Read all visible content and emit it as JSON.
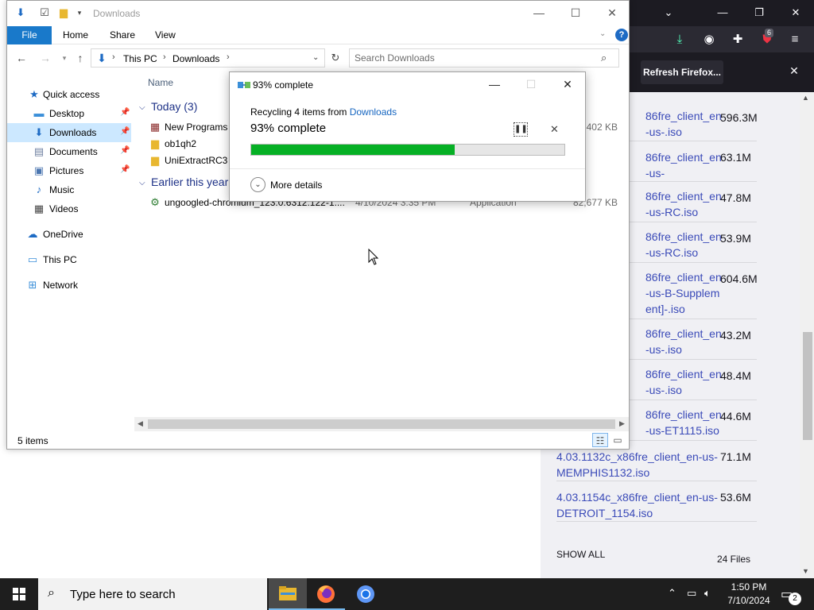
{
  "firefox": {
    "notice_button": "Refresh Firefox...",
    "extension_badge": "6",
    "downloads": [
      {
        "name": "86fre_client_en-us-.iso",
        "size": "596.3M"
      },
      {
        "name": "86fre_client_en-us-",
        "size": "63.1M"
      },
      {
        "name": "86fre_client_en-us-RC.iso",
        "size": "47.8M"
      },
      {
        "name": "86fre_client_en-us-RC.iso",
        "size": "53.9M"
      },
      {
        "name": "86fre_client_en-us-B-Supplement]-.iso",
        "size": "604.6M"
      },
      {
        "name": "86fre_client_en-us-.iso",
        "size": "43.2M"
      },
      {
        "name": "86fre_client_en-us-.iso",
        "size": "48.4M"
      },
      {
        "name": "86fre_client_en-us-ET1115.iso",
        "size": "44.6M"
      },
      {
        "name": "4.03.1132c_x86fre_client_en-us-MEMPHIS1132.iso",
        "size": "71.1M"
      },
      {
        "name": "4.03.1154c_x86fre_client_en-us-DETROIT_1154.iso",
        "size": "53.6M"
      }
    ],
    "show_all": "SHOW ALL",
    "file_count": "24 Files"
  },
  "explorer": {
    "title": "Downloads",
    "ribbon_tabs": {
      "file": "File",
      "home": "Home",
      "share": "Share",
      "view": "View"
    },
    "breadcrumb": [
      "This PC",
      "Downloads"
    ],
    "search_placeholder": "Search Downloads",
    "column_name": "Name",
    "nav": {
      "quick_access": "Quick access",
      "desktop": "Desktop",
      "downloads": "Downloads",
      "documents": "Documents",
      "pictures": "Pictures",
      "music": "Music",
      "videos": "Videos",
      "onedrive": "OneDrive",
      "this_pc": "This PC",
      "network": "Network"
    },
    "groups": {
      "today": "Today (3)",
      "earlier": "Earlier this year"
    },
    "files": [
      {
        "name": "New Programs",
        "date": "",
        "type": "",
        "size": "2,402 KB"
      },
      {
        "name": "ob1qh2",
        "date": "",
        "type": "",
        "size": ""
      },
      {
        "name": "UniExtractRC3",
        "date": "",
        "type": "",
        "size": ""
      },
      {
        "name": "ungoogled-chromium_123.0.6312.122-1....",
        "date": "4/10/2024 3:35 PM",
        "type": "Application",
        "size": "82,677 KB"
      }
    ],
    "status": "5 items"
  },
  "dialog": {
    "title": "93% complete",
    "recycling_prefix": "Recycling 4 items from ",
    "recycling_source": "Downloads",
    "percent_text": "93% complete",
    "progress_percent": 65,
    "more_details": "More details"
  },
  "taskbar": {
    "search_placeholder": "Type here to search",
    "time": "1:50 PM",
    "date": "7/10/2024",
    "notification_count": "2"
  }
}
